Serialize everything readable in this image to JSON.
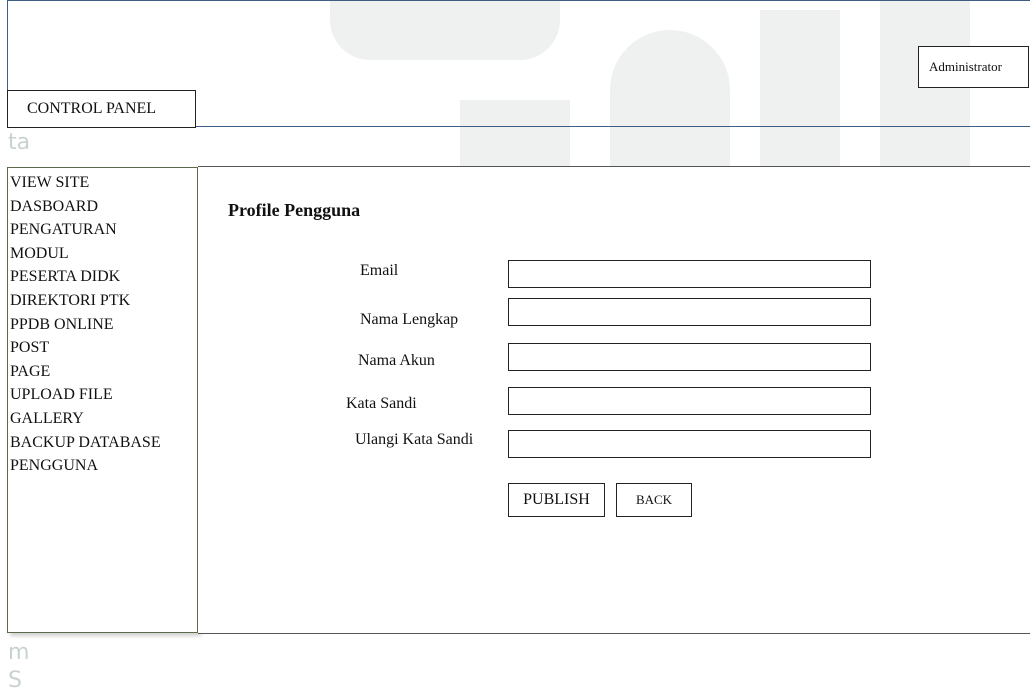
{
  "header": {
    "control_panel_label": "CONTROL PANEL",
    "user_label": "Administrator"
  },
  "sidebar": {
    "items": [
      {
        "label": "VIEW SITE"
      },
      {
        "label": "DASBOARD"
      },
      {
        "label": "PENGATURAN"
      },
      {
        "label": "MODUL"
      },
      {
        "label": "PESERTA DIDK"
      },
      {
        "label": "DIREKTORI PTK"
      },
      {
        "label": "PPDB ONLINE"
      },
      {
        "label": "POST"
      },
      {
        "label": "PAGE"
      },
      {
        "label": "UPLOAD FILE"
      },
      {
        "label": "GALLERY"
      },
      {
        "label": "BACKUP DATABASE"
      },
      {
        "label": "PENGGUNA"
      }
    ]
  },
  "main": {
    "title": "Profile Pengguna",
    "form": {
      "email_label": "Email",
      "email_value": "",
      "fullname_label": "Nama Lengkap",
      "fullname_value": "",
      "username_label": "Nama Akun",
      "username_value": "",
      "password_label": "Kata Sandi",
      "password_value": "",
      "password_repeat_label": "Ulangi Kata Sandi",
      "password_repeat_value": ""
    },
    "buttons": {
      "publish_label": "PUBLISH",
      "back_label": "BACK"
    }
  },
  "colors": {
    "header_border": "#3d5f86",
    "sidebar_border": "#5a6a4c",
    "watermark": "#eef1ef"
  }
}
